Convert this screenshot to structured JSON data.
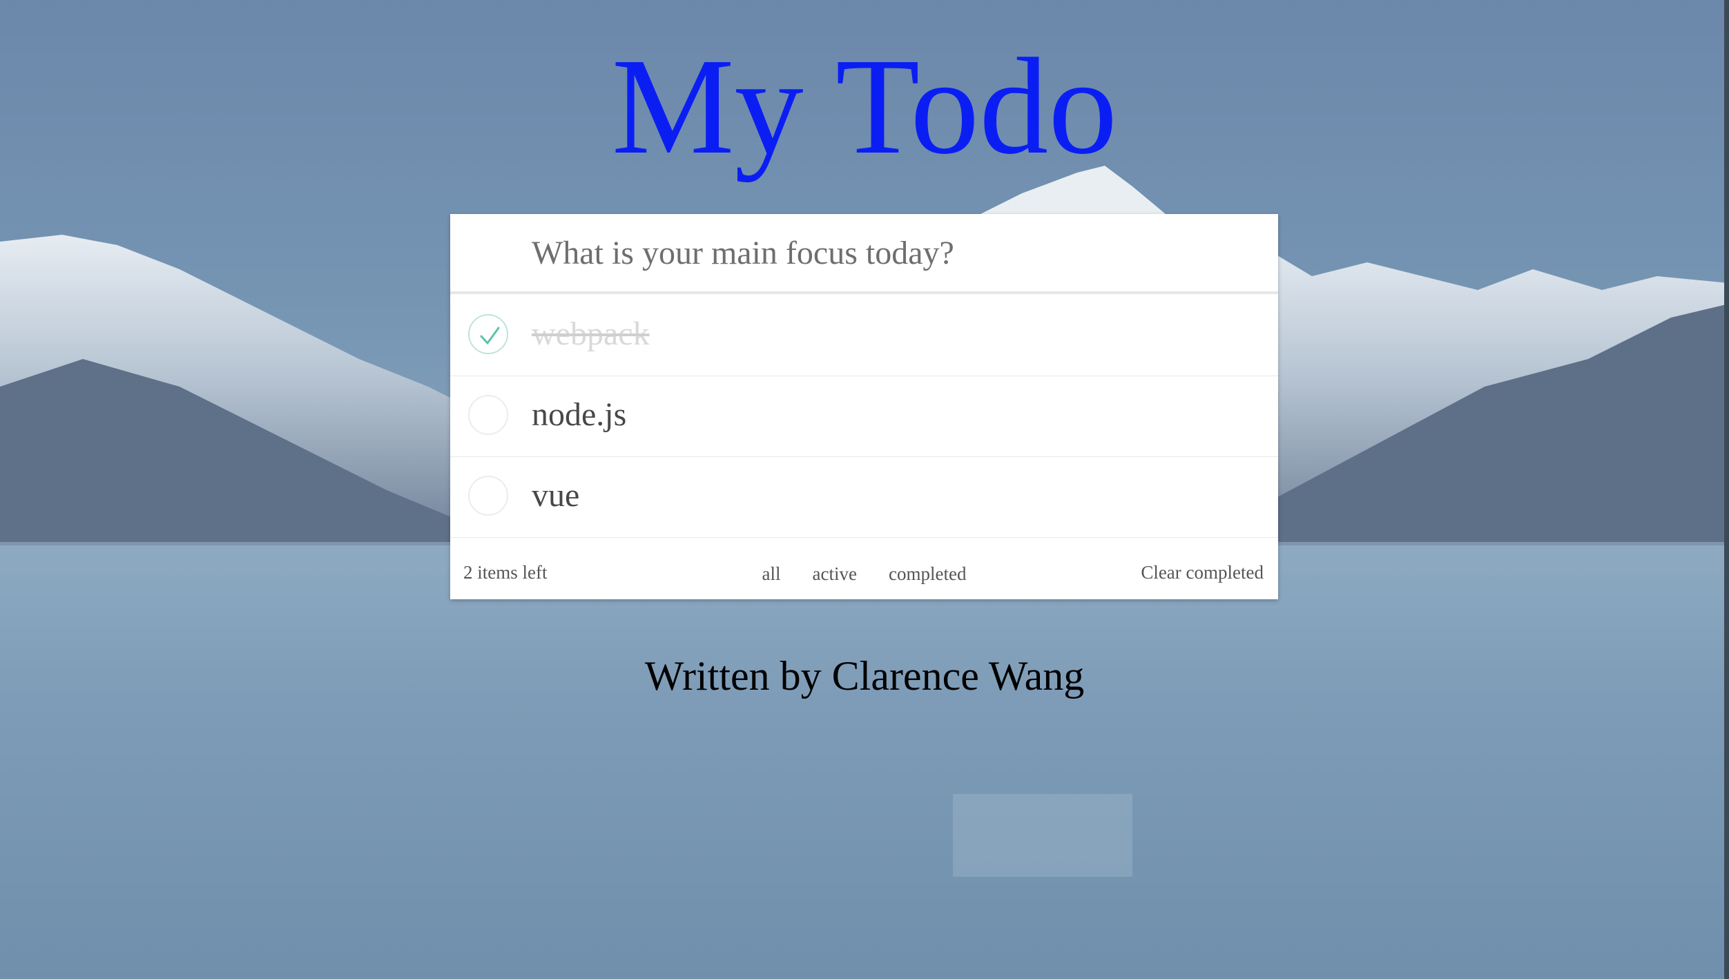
{
  "app": {
    "title": "My Todo"
  },
  "new_todo": {
    "placeholder": "What is your main focus today?",
    "value": ""
  },
  "todos": [
    {
      "label": "webpack",
      "completed": true
    },
    {
      "label": "node.js",
      "completed": false
    },
    {
      "label": "vue",
      "completed": false
    }
  ],
  "footer": {
    "items_left": "2 items left",
    "filters": [
      "all",
      "active",
      "completed"
    ],
    "clear_completed": "Clear completed"
  },
  "credit": "Written by Clarence Wang",
  "colors": {
    "title": "#0a1ef4",
    "check": "#5dc2af",
    "sky": "#6f8cab",
    "lake": "#7b9ab6"
  },
  "icons": {
    "check": "check-icon"
  }
}
